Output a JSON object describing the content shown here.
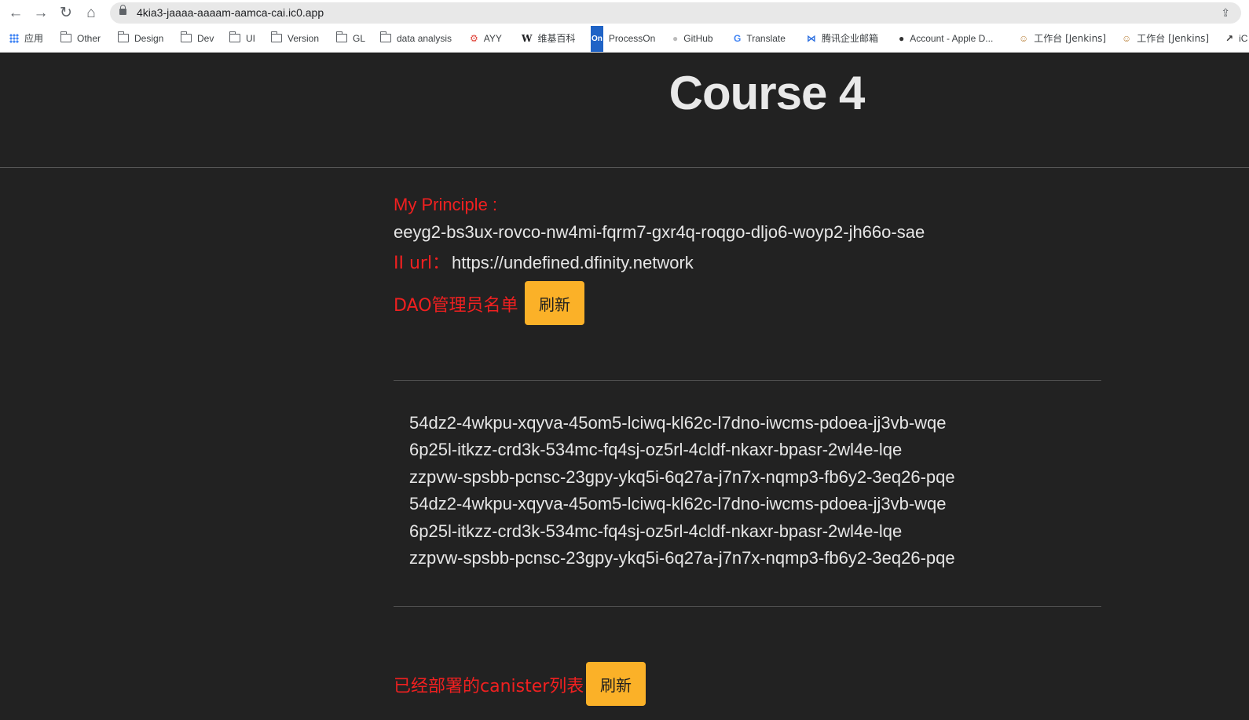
{
  "browser": {
    "url": "4kia3-jaaaa-aaaam-aamca-cai.ic0.app",
    "nav_icons": [
      "back-arrow-icon",
      "forward-arrow-icon",
      "reload-icon",
      "home-icon"
    ],
    "bookmarks": [
      {
        "label": "应用",
        "icon": "apps-grid-icon"
      },
      {
        "label": "Other",
        "icon": "folder-icon"
      },
      {
        "label": "Design",
        "icon": "folder-icon"
      },
      {
        "label": "Dev",
        "icon": "folder-icon"
      },
      {
        "label": "UI",
        "icon": "folder-icon"
      },
      {
        "label": "Version",
        "icon": "folder-icon"
      },
      {
        "label": "GL",
        "icon": "folder-icon"
      },
      {
        "label": "data analysis",
        "icon": "folder-icon"
      },
      {
        "label": "AYY",
        "icon": "ayy-logo-icon"
      },
      {
        "label": "维基百科",
        "icon": "wikipedia-icon"
      },
      {
        "label": "ProcessOn",
        "icon": "processon-icon"
      },
      {
        "label": "GitHub",
        "icon": "github-icon"
      },
      {
        "label": "Translate",
        "icon": "translate-icon"
      },
      {
        "label": "腾讯企业邮箱",
        "icon": "tencent-mail-icon"
      },
      {
        "label": "Account - Apple D...",
        "icon": "apple-icon"
      },
      {
        "label": "工作台 [Jenkins]",
        "icon": "jenkins-icon"
      },
      {
        "label": "工作台 [Jenkins]",
        "icon": "jenkins-icon"
      },
      {
        "label": "iC",
        "icon": "link-icon"
      }
    ]
  },
  "page": {
    "title": "Course 4",
    "principle_label": "My Principle :",
    "principle_value": "eeyg2-bs3ux-rovco-nw4mi-fqrm7-gxr4q-roqgo-dljo6-woyp2-jh66o-sae",
    "ii_url_label": "II url：",
    "ii_url_value": "https://undefined.dfinity.network",
    "dao_admins_label": "DAO管理员名单",
    "refresh_label": "刷新",
    "admins": [
      "54dz2-4wkpu-xqyva-45om5-lciwq-kl62c-l7dno-iwcms-pdoea-jj3vb-wqe",
      "6p25l-itkzz-crd3k-534mc-fq4sj-oz5rl-4cldf-nkaxr-bpasr-2wl4e-lqe",
      "zzpvw-spsbb-pcnsc-23gpy-ykq5i-6q27a-j7n7x-nqmp3-fb6y2-3eq26-pqe",
      "54dz2-4wkpu-xqyva-45om5-lciwq-kl62c-l7dno-iwcms-pdoea-jj3vb-wqe",
      "6p25l-itkzz-crd3k-534mc-fq4sj-oz5rl-4cldf-nkaxr-bpasr-2wl4e-lqe",
      "zzpvw-spsbb-pcnsc-23gpy-ykq5i-6q27a-j7n7x-nqmp3-fb6y2-3eq26-pqe"
    ],
    "canister_list_label": "已经部署的canister列表",
    "canister_refresh_label": "刷新"
  },
  "colors": {
    "background": "#222222",
    "label_red": "#f02020",
    "button_orange": "#fbb128",
    "text_light": "#e6e6e6"
  }
}
